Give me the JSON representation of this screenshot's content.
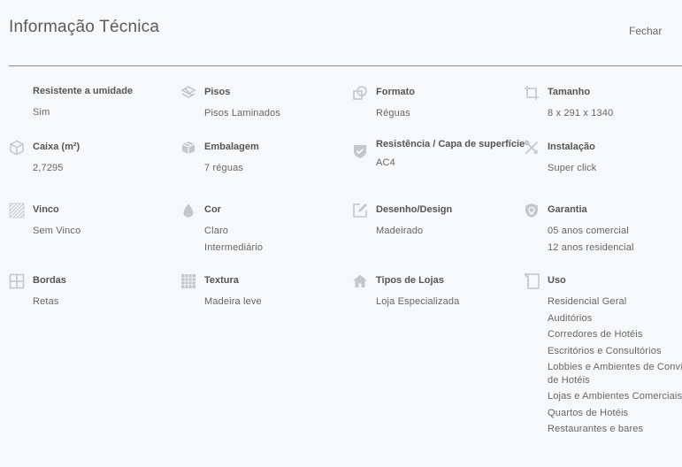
{
  "header": {
    "title": "Informação Técnica",
    "close_label": "Fechar"
  },
  "specs": [
    {
      "label": "Resistente a umidade",
      "icon": "water-drop-icon",
      "values": [
        "Sim"
      ]
    },
    {
      "label": "Pisos",
      "icon": "floor-layers-icon",
      "values": [
        "Pisos Laminados"
      ]
    },
    {
      "label": "Formato",
      "icon": "format-shapes-icon",
      "values": [
        "Réguas"
      ]
    },
    {
      "label": "Tamanho",
      "icon": "crop-size-icon",
      "values": [
        "8 x 291 x 1340"
      ]
    },
    {
      "label": "Caixa (m²)",
      "icon": "box-icon",
      "values": [
        "2,7295"
      ]
    },
    {
      "label": "Embalagem",
      "icon": "package-icon",
      "values": [
        "7 réguas"
      ]
    },
    {
      "label": "Resistência / Capa de superfície",
      "icon": "shield-check-icon",
      "values": [
        "AC4"
      ]
    },
    {
      "label": "Instalação",
      "icon": "tools-icon",
      "values": [
        "Super click"
      ]
    },
    {
      "label": "Vinco",
      "icon": "hatch-pattern-icon",
      "values": [
        "Sem Vinco"
      ]
    },
    {
      "label": "Cor",
      "icon": "color-drop-icon",
      "values": [
        "Claro",
        "Intermediário"
      ]
    },
    {
      "label": "Desenho/Design",
      "icon": "pencil-edit-icon",
      "values": [
        "Madeirado"
      ]
    },
    {
      "label": "Garantia",
      "icon": "warranty-shield-icon",
      "values": [
        "05 anos comercial",
        "12 anos residencial"
      ]
    },
    {
      "label": "Bordas",
      "icon": "border-grid-icon",
      "values": [
        "Retas"
      ]
    },
    {
      "label": "Textura",
      "icon": "texture-grid-icon",
      "values": [
        "Madeira leve"
      ]
    },
    {
      "label": "Tipos de Lojas",
      "icon": "home-store-icon",
      "values": [
        "Loja Especializada"
      ]
    },
    {
      "label": "Uso",
      "icon": "usage-door-icon",
      "values": [
        "Residencial Geral",
        "Auditórios",
        "Corredores de Hotéis",
        "Escritórios e Consultórios",
        "Lobbies e Ambientes de Convívio de Hotéis",
        "Lojas e Ambientes Comerciais",
        "Quartos de Hotéis",
        "Restaurantes e bares"
      ]
    }
  ],
  "colors": {
    "background": "#f7f8fa",
    "icon": "#c4c7cc",
    "text": "#666666",
    "divider": "#8c8c8c"
  }
}
